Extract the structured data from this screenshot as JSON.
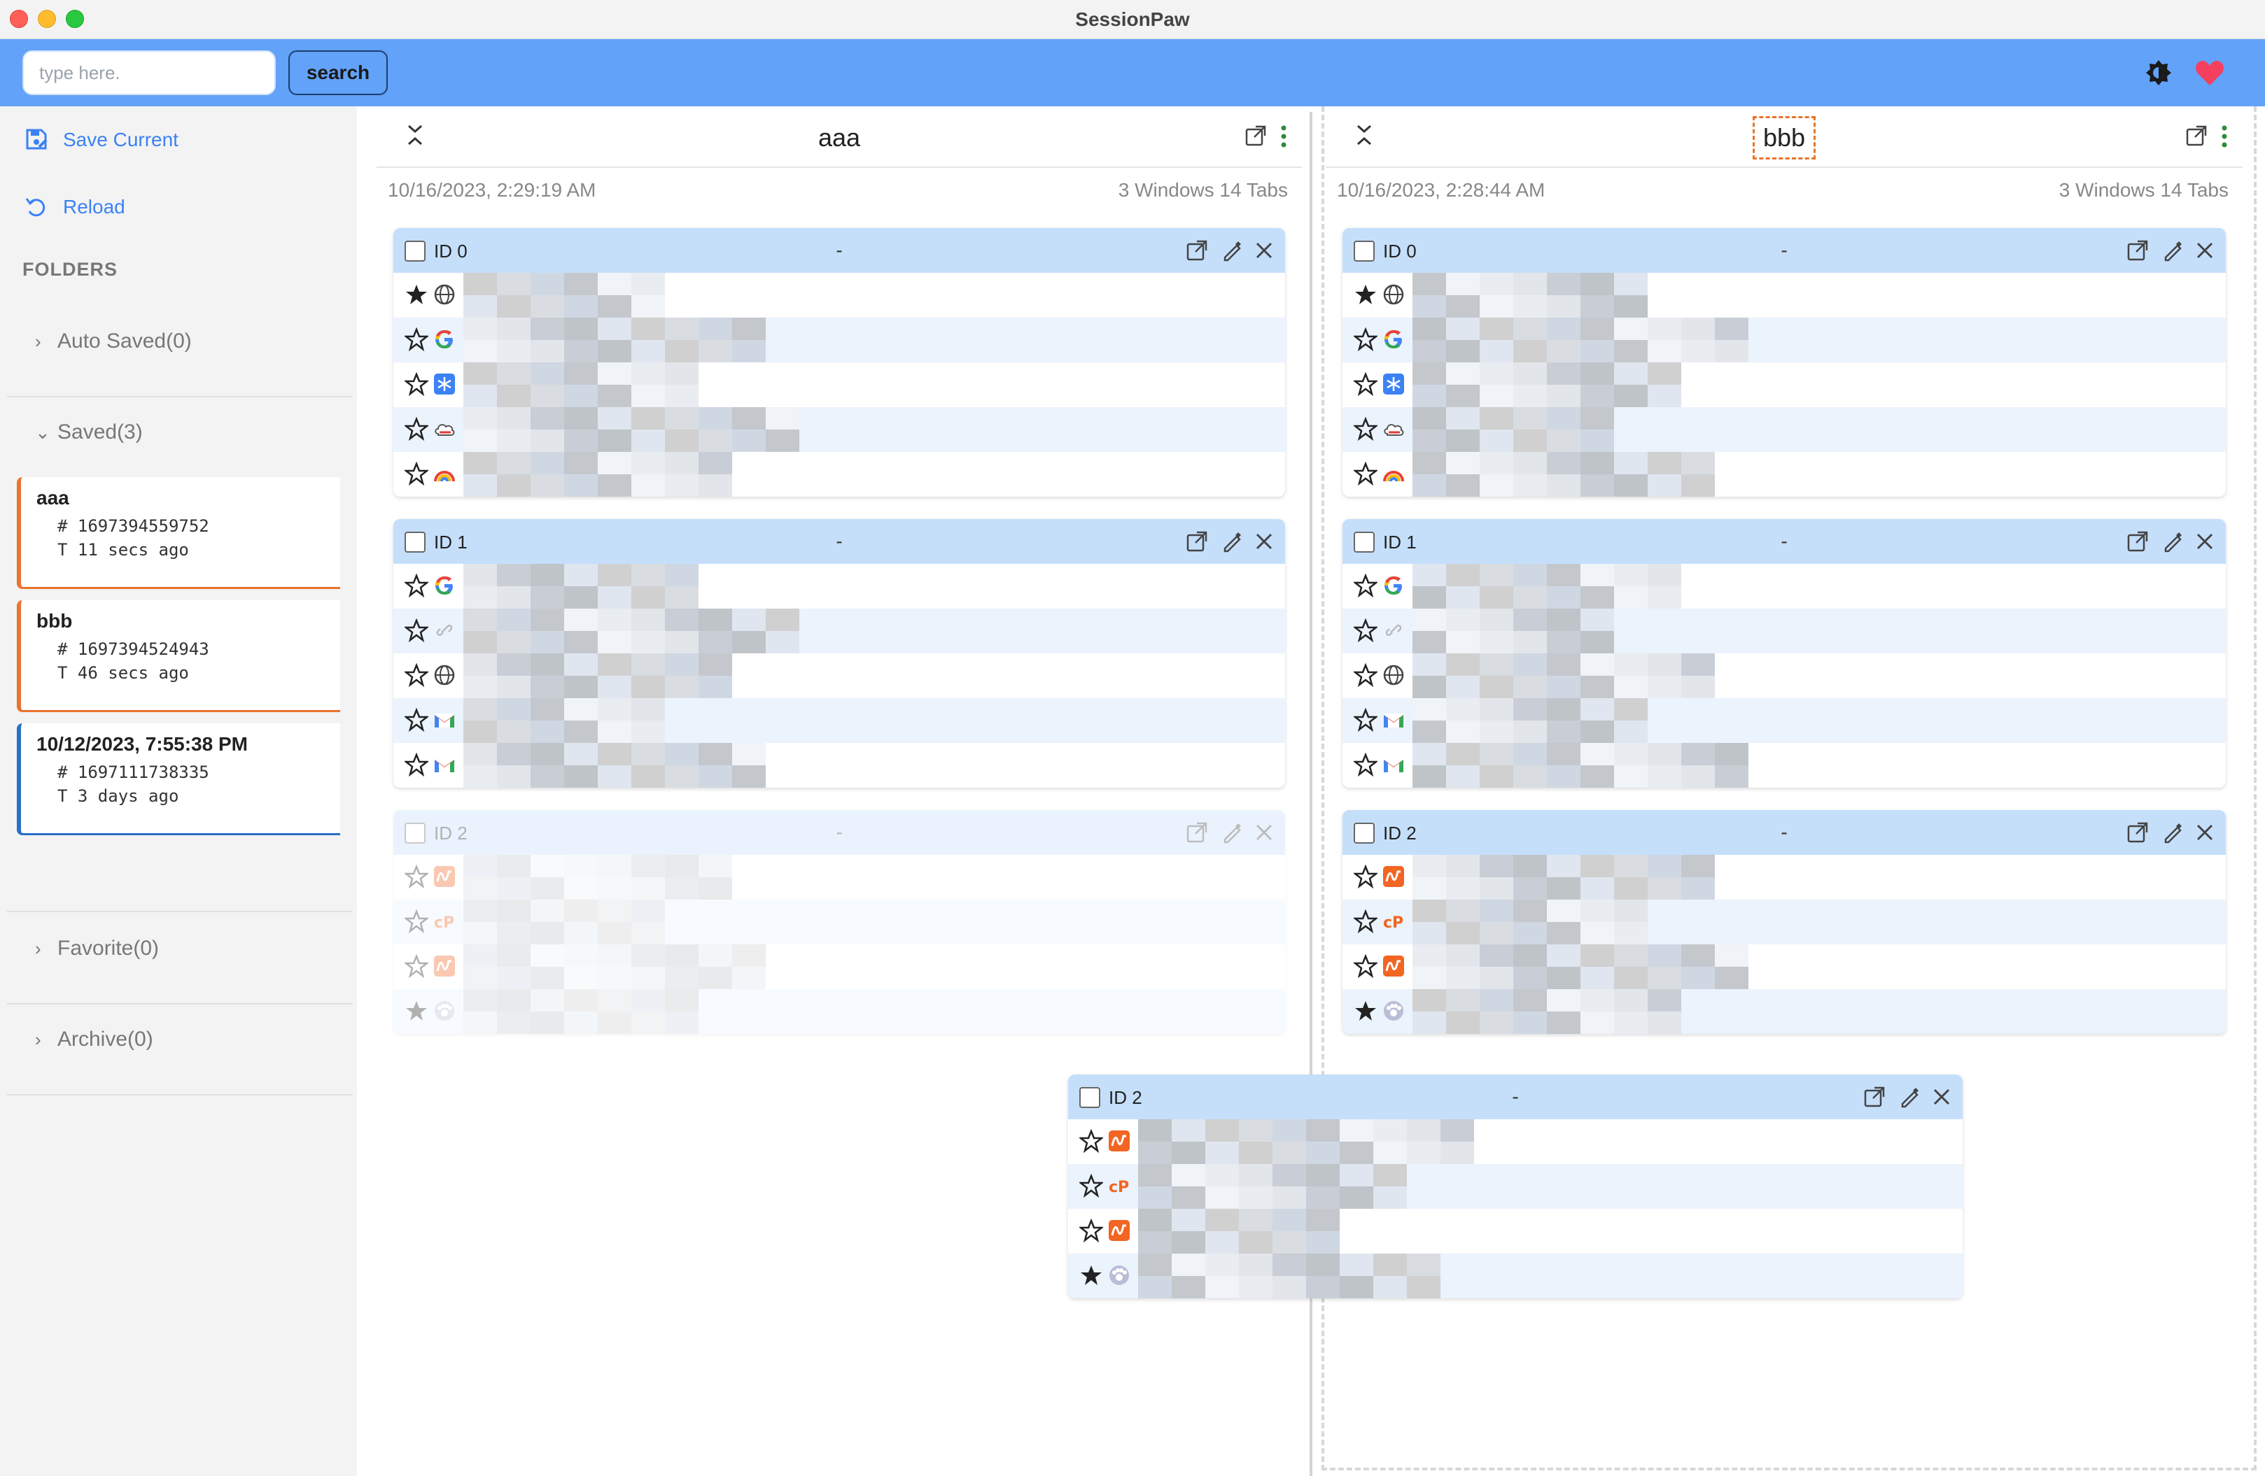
{
  "app": {
    "title": "SessionPaw"
  },
  "toolbar": {
    "search_placeholder": "type here.",
    "search_label": "search",
    "theme_icon": "brightness-icon",
    "heart_icon": "heart-icon",
    "heart_color": "#f43f5e",
    "accent": "#62a2f8"
  },
  "sidebar": {
    "save_current": "Save Current",
    "reload": "Reload",
    "folders_header": "FOLDERS",
    "auto_saved": "Auto Saved(0)",
    "saved": "Saved(3)",
    "favorite": "Favorite(0)",
    "archive": "Archive(0)",
    "sessions": [
      {
        "name": "aaa",
        "id": "# 1697394559752",
        "time": "T 11 secs ago"
      },
      {
        "name": "bbb",
        "id": "# 1697394524943",
        "time": "T 46 secs ago"
      },
      {
        "name": "10/12/2023, 7:55:38 PM",
        "id": "# 1697111738335",
        "time": "T 3 days ago"
      }
    ]
  },
  "panels": [
    {
      "title": "aaa",
      "date": "10/16/2023, 2:29:19 AM",
      "count": "3 Windows 14 Tabs",
      "windows": [
        {
          "id": "ID 0",
          "dash": "-",
          "tabs": [
            "globe",
            "google",
            "snowflake",
            "cloud",
            "rainbow"
          ],
          "starred": [
            true,
            false,
            false,
            false,
            false
          ]
        },
        {
          "id": "ID 1",
          "dash": "-",
          "tabs": [
            "google",
            "link",
            "globe",
            "gmail",
            "gmail"
          ],
          "starred": [
            false,
            false,
            false,
            false,
            false
          ]
        },
        {
          "id": "ID 2",
          "dash": "-",
          "tabs": [
            "wave",
            "cp",
            "wave",
            "paw"
          ],
          "starred": [
            false,
            false,
            false,
            true
          ]
        }
      ]
    },
    {
      "title": "bbb",
      "date": "10/16/2023, 2:28:44 AM",
      "count": "3 Windows 14 Tabs",
      "windows": [
        {
          "id": "ID 0",
          "dash": "-",
          "tabs": [
            "globe",
            "google",
            "snowflake",
            "cloud",
            "rainbow"
          ],
          "starred": [
            true,
            false,
            false,
            false,
            false
          ]
        },
        {
          "id": "ID 1",
          "dash": "-",
          "tabs": [
            "google",
            "link",
            "globe",
            "gmail",
            "gmail"
          ],
          "starred": [
            false,
            false,
            false,
            false,
            false
          ]
        },
        {
          "id": "ID 2",
          "dash": "-",
          "tabs": [
            "wave",
            "cp",
            "wave",
            "paw"
          ],
          "starred": [
            false,
            false,
            false,
            true
          ]
        }
      ]
    }
  ],
  "dragging": {
    "id": "ID 2",
    "dash": "-",
    "tabs": [
      "wave",
      "cp",
      "wave",
      "paw"
    ],
    "starred": [
      false,
      false,
      false,
      true
    ]
  }
}
